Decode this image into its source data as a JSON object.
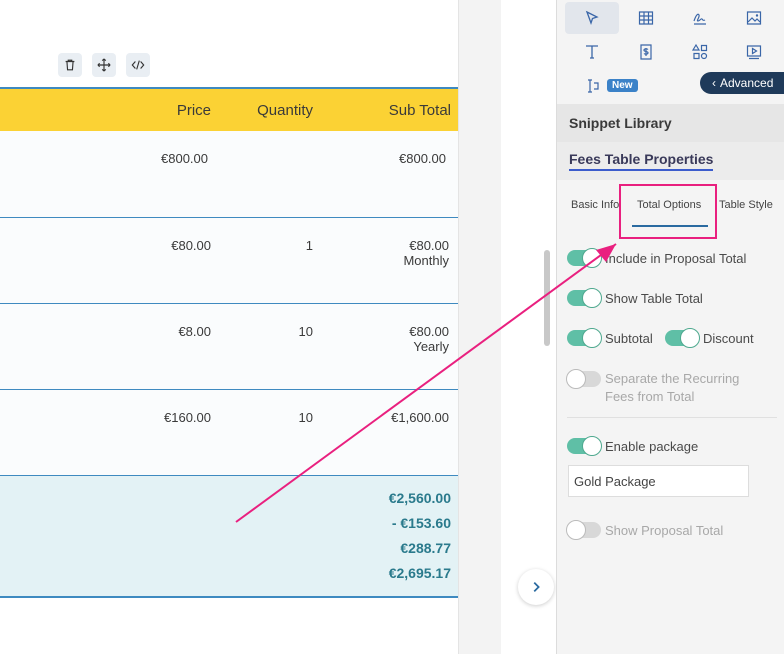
{
  "table": {
    "headers": {
      "price": "Price",
      "quantity": "Quantity",
      "subtotal": "Sub Total"
    },
    "rows": [
      {
        "price": "€800.00",
        "quantity": "",
        "subtotal": "€800.00",
        "frequency": ""
      },
      {
        "price": "€80.00",
        "quantity": "1",
        "subtotal": "€80.00",
        "frequency": "Monthly"
      },
      {
        "price": "€8.00",
        "quantity": "10",
        "subtotal": "€80.00",
        "frequency": "Yearly"
      },
      {
        "price": "€160.00",
        "quantity": "10",
        "subtotal": "€1,600.00",
        "frequency": ""
      }
    ],
    "totals": [
      "€2,560.00",
      "- €153.60",
      "€288.77",
      "€2,695.17"
    ]
  },
  "toolbar": {
    "icons": [
      "trash-icon",
      "move-icon",
      "code-icon"
    ]
  },
  "panel": {
    "tools": [
      "pointer-icon",
      "table-icon",
      "signature-icon",
      "image-icon",
      "text-icon",
      "fee-doc-icon",
      "shapes-icon",
      "video-icon",
      "text-cursor-icon"
    ],
    "new_badge": "New",
    "advanced_label": "Advanced",
    "snippet_library": "Snippet Library",
    "properties_title": "Fees Table Properties",
    "tabs": {
      "basic": "Basic Info",
      "total": "Total Options",
      "style": "Table Style"
    },
    "options": {
      "include_total": "Include in Proposal Total",
      "show_table_total": "Show Table Total",
      "subtotal": "Subtotal",
      "discount": "Discount",
      "separate_line1": "Separate the Recurring",
      "separate_line2": "Fees from Total",
      "enable_package": "Enable package",
      "package_value": "Gold Package",
      "show_proposal_total": "Show Proposal Total"
    }
  },
  "colors": {
    "header_yellow": "#fbd234",
    "table_border": "#3e8ac0",
    "totals_text": "#2a7a8c",
    "toggle_on": "#5fbfa6",
    "highlight": "#e9207f",
    "advanced_bg": "#1f3a5a"
  }
}
